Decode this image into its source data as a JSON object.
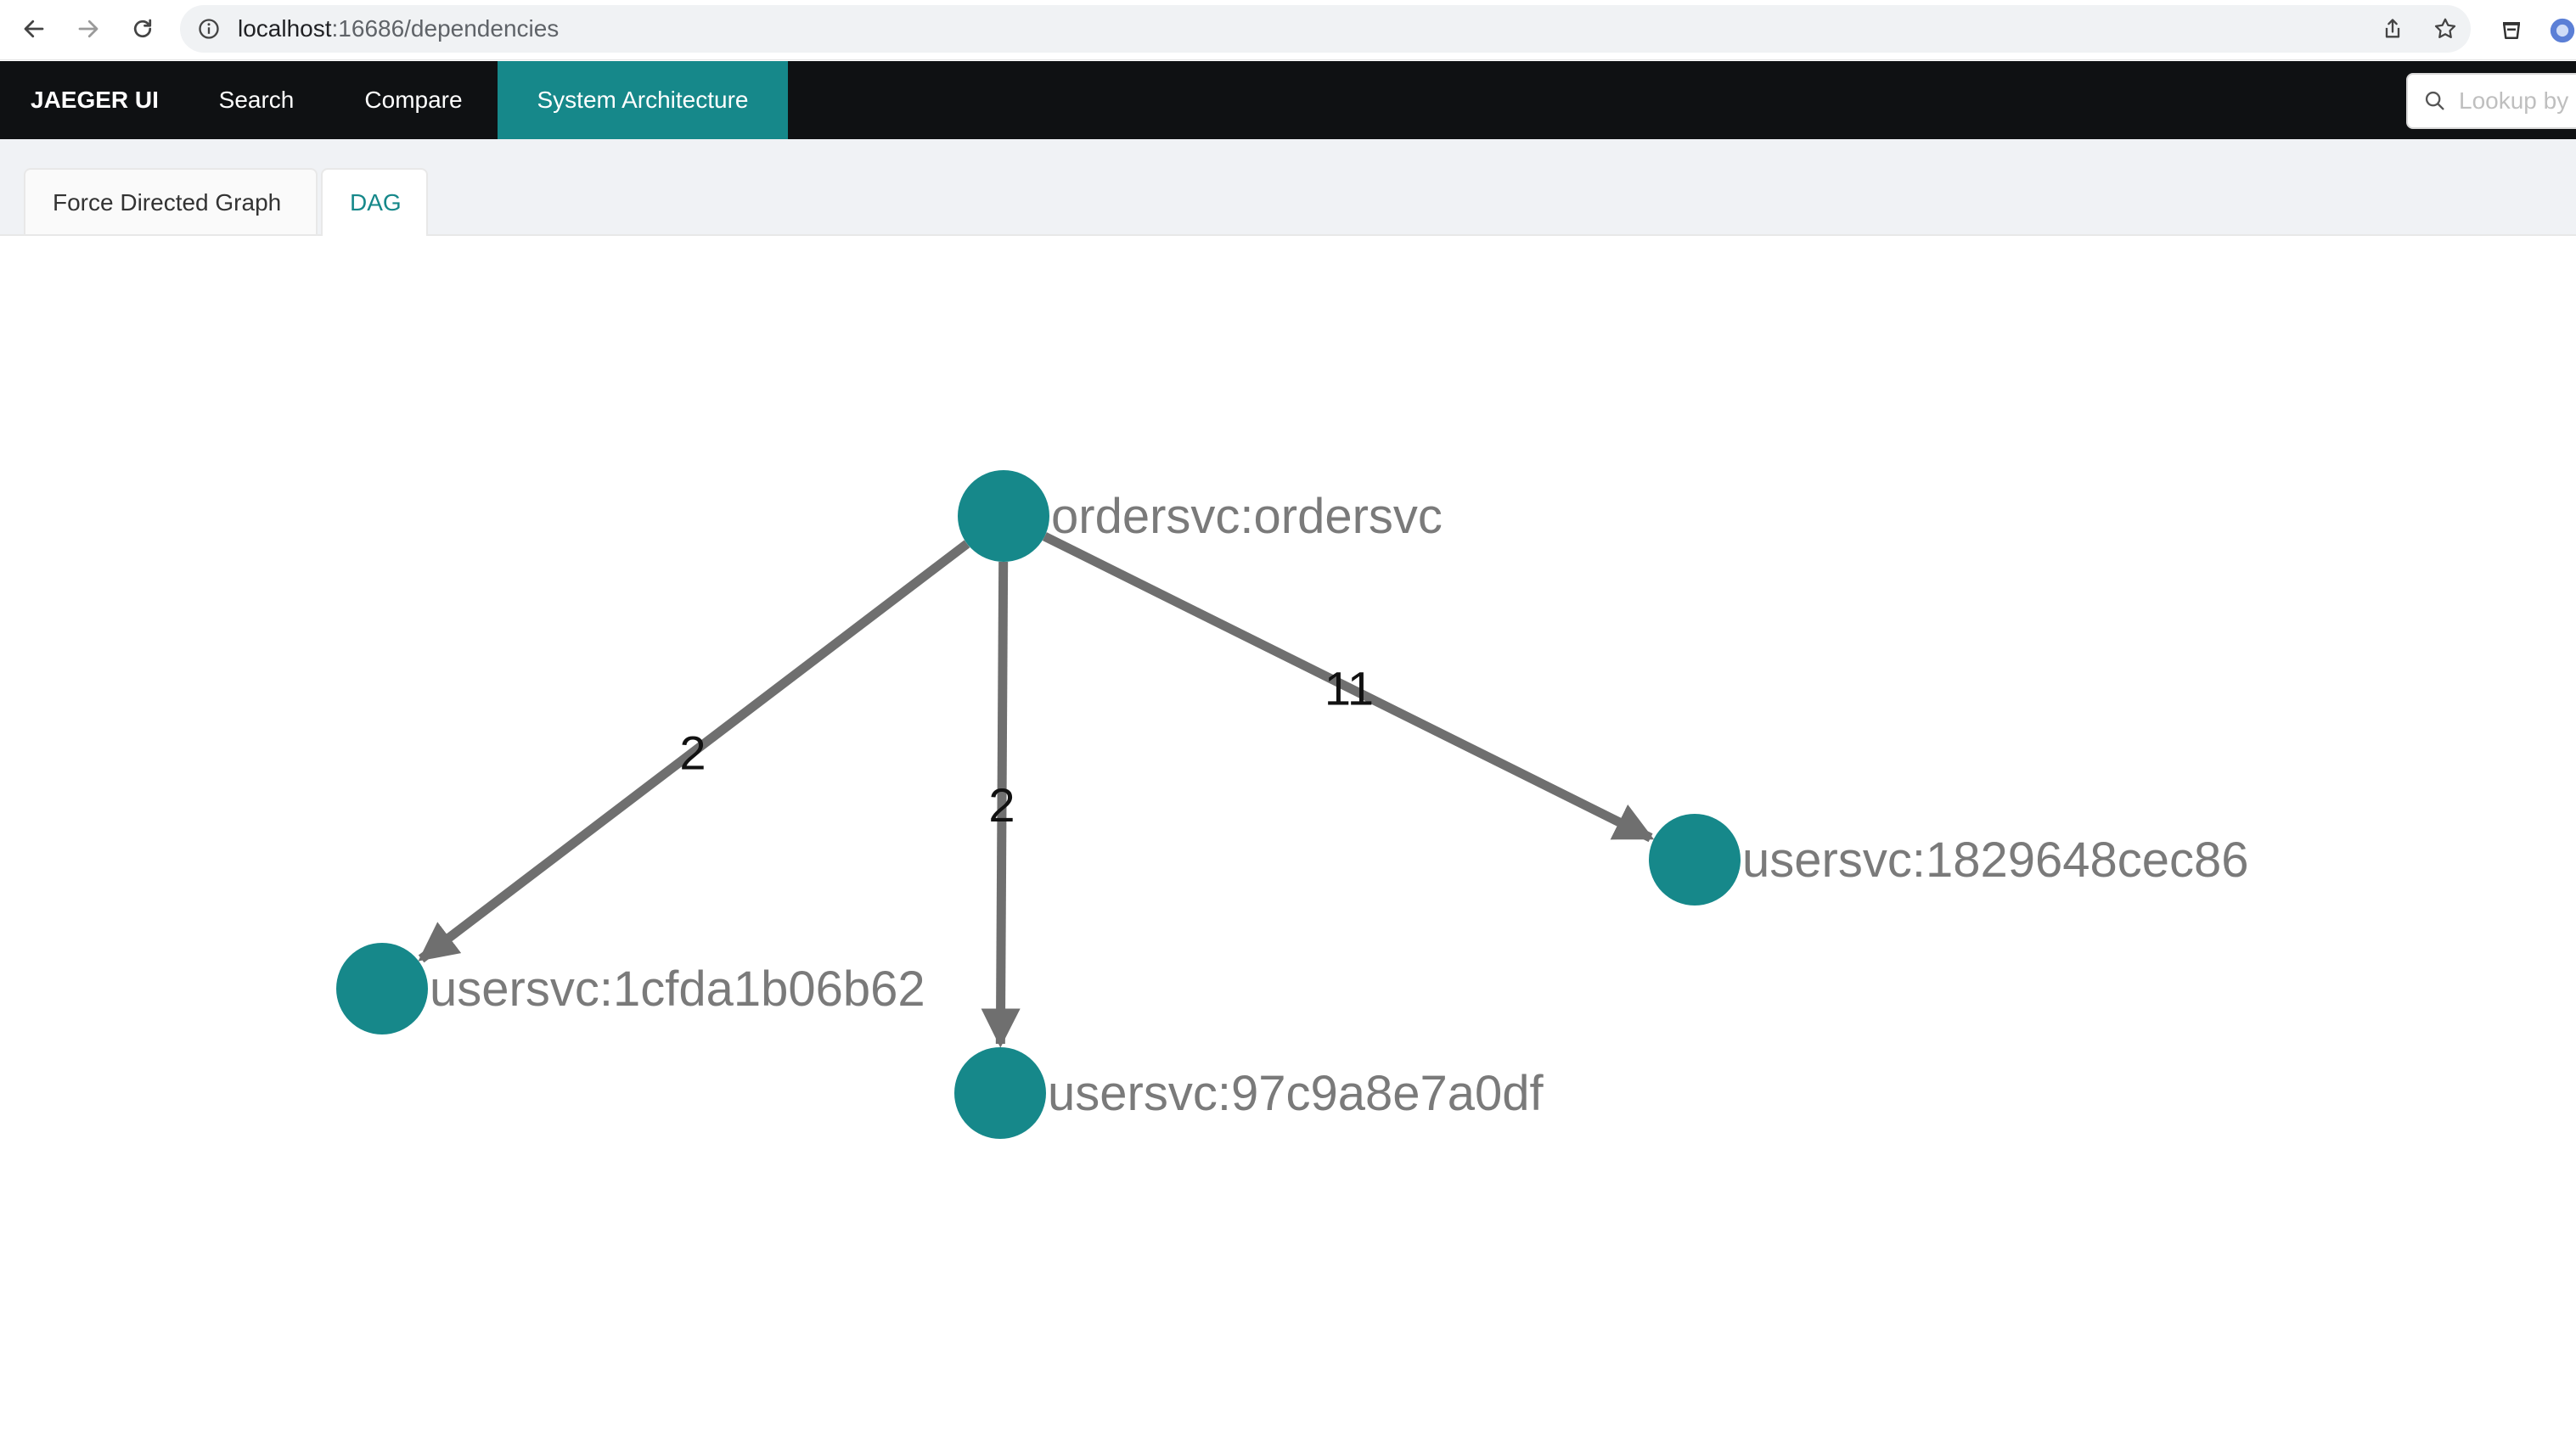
{
  "browser": {
    "url_host": "localhost",
    "url_path": ":16686/dependencies"
  },
  "nav": {
    "brand": "JAEGER UI",
    "items": [
      {
        "label": "Search",
        "active": false
      },
      {
        "label": "Compare",
        "active": false
      },
      {
        "label": "System Architecture",
        "active": true
      }
    ],
    "lookup_placeholder": "Lookup by"
  },
  "tabs": [
    {
      "label": "Force Directed Graph",
      "active": false
    },
    {
      "label": "DAG",
      "active": true
    }
  ],
  "graph": {
    "node_color": "#16888a",
    "edge_color": "#6f6f6f",
    "nodes": [
      {
        "id": "ordersvc:ordersvc"
      },
      {
        "id": "usersvc:1cfda1b06b62"
      },
      {
        "id": "usersvc:97c9a8e7a0df"
      },
      {
        "id": "usersvc:1829648cec86"
      }
    ],
    "edges": [
      {
        "from": "ordersvc:ordersvc",
        "to": "usersvc:1cfda1b06b62",
        "calls": 2
      },
      {
        "from": "ordersvc:ordersvc",
        "to": "usersvc:97c9a8e7a0df",
        "calls": 2
      },
      {
        "from": "ordersvc:ordersvc",
        "to": "usersvc:1829648cec86",
        "calls": 11
      }
    ]
  }
}
